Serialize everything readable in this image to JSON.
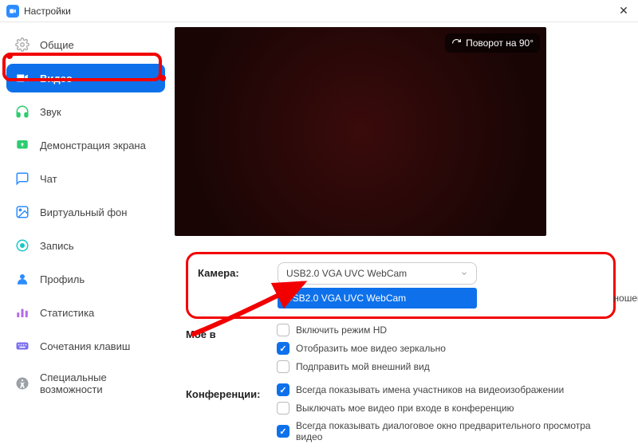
{
  "titlebar": {
    "title": "Настройки"
  },
  "sidebar": {
    "items": [
      {
        "label": "Общие"
      },
      {
        "label": "Видео"
      },
      {
        "label": "Звук"
      },
      {
        "label": "Демонстрация экрана"
      },
      {
        "label": "Чат"
      },
      {
        "label": "Виртуальный фон"
      },
      {
        "label": "Запись"
      },
      {
        "label": "Профиль"
      },
      {
        "label": "Статистика"
      },
      {
        "label": "Сочетания клавиш"
      },
      {
        "label": "Специальные возможности"
      }
    ]
  },
  "main": {
    "rotate_label": "Поворот на 90°",
    "camera_label": "Камера:",
    "camera_selected": "USB2.0 VGA UVC WebCam",
    "camera_option": "USB2.0 VGA UVC WebCam",
    "my_video_label": "Мое в",
    "aspect_suffix": "ношение",
    "hd_label": "Включить режим HD",
    "mirror_label": "Отобразить мое видео зеркально",
    "touchup_label": "Подправить мой внешний вид",
    "conf_label": "Конференции:",
    "show_names_label": "Всегда показывать имена участников на видеоизображении",
    "mute_video_label": "Выключать мое видео при входе в конференцию",
    "preview_label": "Всегда показывать диалоговое окно предварительного просмотра видео"
  },
  "colors": {
    "accent": "#0e71eb",
    "annotation": "#f20000"
  }
}
